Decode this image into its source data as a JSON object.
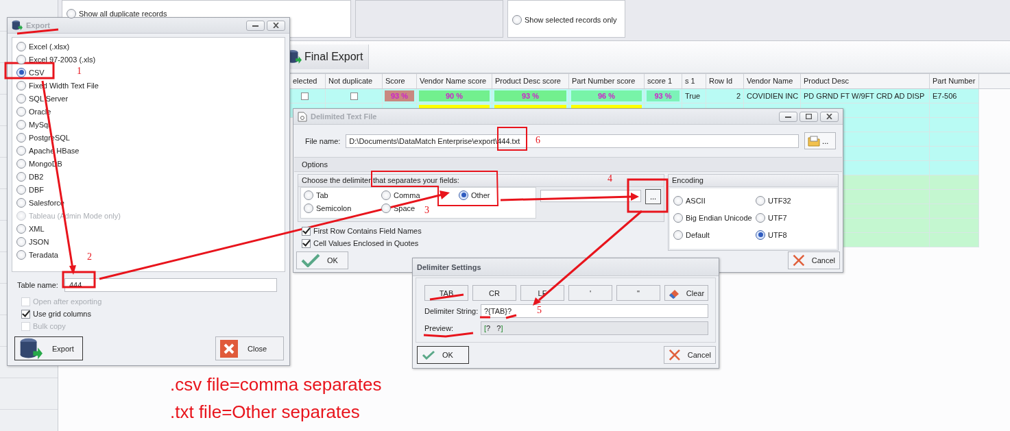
{
  "filter_panel": {
    "options": [
      {
        "label": "Show all duplicate records",
        "selected": false
      },
      {
        "label": "Show selected records only",
        "selected": false
      }
    ]
  },
  "toolbar": {
    "final_export": "Final Export"
  },
  "grid": {
    "columns": [
      "elected",
      "Not duplicate",
      "Score",
      "Vendor Name score",
      "Product Desc score",
      "Part Number score",
      "score 1",
      "s 1",
      "Row Id",
      "Vendor Name",
      "Product Desc",
      "Part Number"
    ],
    "rows": [
      {
        "color": "#b9fbf4",
        "cells": [
          {
            "kind": "checkbox",
            "checked": false
          },
          {
            "kind": "checkbox",
            "checked": false
          },
          {
            "kind": "match",
            "text": "93 %",
            "color": "#c98880"
          },
          {
            "kind": "match",
            "text": "90 %",
            "color": "#72f08e"
          },
          {
            "kind": "match",
            "text": "93 %",
            "color": "#72f08e"
          },
          {
            "kind": "match",
            "text": "96 %",
            "color": "#78f4a8"
          },
          {
            "kind": "match",
            "text": "93 %",
            "color": "#7cf2b8"
          },
          {
            "kind": "text",
            "text": "True"
          },
          {
            "kind": "number",
            "text": "2"
          },
          {
            "kind": "text",
            "text": "COVIDIEN INC"
          },
          {
            "kind": "text",
            "text": "PD GRND FT W/9FT CRD AD DISP"
          },
          {
            "kind": "text",
            "text": "E7-506"
          }
        ]
      },
      {
        "color": "#b9fbf4",
        "cells": [
          {
            "kind": "blank"
          },
          {
            "kind": "blank"
          },
          {
            "kind": "blank"
          },
          {
            "kind": "miss",
            "color": "#ffff00"
          },
          {
            "kind": "miss",
            "color": "#ffff00"
          },
          {
            "kind": "miss",
            "color": "#ffff00"
          }
        ]
      },
      {
        "color": "#b9fbf4"
      },
      {
        "color": "#b9fbf4"
      },
      {
        "color": "#b9fbf4"
      },
      {
        "color": "#b9fbf4"
      },
      {
        "color": "#c4f7d0"
      },
      {
        "color": "#c4f7d0"
      },
      {
        "color": "#c4f7d0"
      },
      {
        "color": "#c4f7d0"
      },
      {
        "color": "#c4f7d0"
      }
    ]
  },
  "export": {
    "title": "Export",
    "active": false,
    "formats": [
      {
        "label": "Excel (.xlsx)",
        "selected": false,
        "disabled": false
      },
      {
        "label": "Excel 97-2003 (.xls)",
        "selected": false,
        "disabled": false
      },
      {
        "label": "CSV",
        "selected": true,
        "disabled": false
      },
      {
        "label": "Fixed Width Text File",
        "selected": false,
        "disabled": false
      },
      {
        "label": "SQL Server",
        "selected": false,
        "disabled": false
      },
      {
        "label": "Oracle",
        "selected": false,
        "disabled": false
      },
      {
        "label": "MySql",
        "selected": false,
        "disabled": false
      },
      {
        "label": "PostgreSQL",
        "selected": false,
        "disabled": false
      },
      {
        "label": "Apache HBase",
        "selected": false,
        "disabled": false
      },
      {
        "label": "MongoDB",
        "selected": false,
        "disabled": false
      },
      {
        "label": "DB2",
        "selected": false,
        "disabled": false
      },
      {
        "label": "DBF",
        "selected": false,
        "disabled": false
      },
      {
        "label": "Salesforce",
        "selected": false,
        "disabled": false
      },
      {
        "label": "Tableau (Admin Mode only)",
        "selected": false,
        "disabled": true
      },
      {
        "label": "XML",
        "selected": false,
        "disabled": false
      },
      {
        "label": "JSON",
        "selected": false,
        "disabled": false
      },
      {
        "label": "Teradata",
        "selected": false,
        "disabled": false
      }
    ],
    "table_name_label": "Table name:",
    "table_name": "444",
    "options": [
      {
        "label": "Open after exporting",
        "checked": false,
        "disabled": true
      },
      {
        "label": "Use grid columns",
        "checked": true,
        "disabled": false
      },
      {
        "label": "Bulk copy",
        "checked": false,
        "disabled": true
      }
    ],
    "export_button": "Export",
    "close_button": "Close"
  },
  "delimited": {
    "title": "Delimited Text File",
    "active": false,
    "file_label": "File name:",
    "file_name": "D:\\Documents\\DataMatch Enterprise\\export\\444.txt",
    "browse_button": "...",
    "options_heading": "Options",
    "delimiter_heading": "Choose the delimiter that separates your fields:",
    "delimiters": [
      {
        "label": "Tab",
        "selected": false
      },
      {
        "label": "Comma",
        "selected": false
      },
      {
        "label": "Other",
        "selected": true
      },
      {
        "label": "Semicolon",
        "selected": false
      },
      {
        "label": "Space",
        "selected": false
      }
    ],
    "other_button": "...",
    "checks": [
      {
        "label": "First Row Contains Field Names",
        "checked": true
      },
      {
        "label": "Cell Values Enclosed in Quotes",
        "checked": true
      }
    ],
    "encoding_heading": "Encoding",
    "encodings": [
      {
        "label": "ASCII",
        "selected": false
      },
      {
        "label": "UTF32",
        "selected": false
      },
      {
        "label": "Big Endian Unicode",
        "selected": false
      },
      {
        "label": "UTF7",
        "selected": false
      },
      {
        "label": "Default",
        "selected": false
      },
      {
        "label": "UTF8",
        "selected": true
      }
    ],
    "ok": "OK",
    "cancel": "Cancel"
  },
  "delimiter_settings": {
    "title": "Delimiter Settings",
    "active": true,
    "buttons": [
      {
        "label": "TAB",
        "kind": "insert"
      },
      {
        "label": "CR",
        "kind": "insert"
      },
      {
        "label": "LF",
        "kind": "insert"
      },
      {
        "label": "'",
        "kind": "insert"
      },
      {
        "label": "\"",
        "kind": "insert"
      },
      {
        "label": "Clear",
        "kind": "clear"
      }
    ],
    "string_label": "Delimiter String:",
    "string_value": "?{TAB}?",
    "preview_label": "Preview:",
    "preview": "[?   ?]",
    "ok": "OK",
    "cancel": "Cancel"
  },
  "annotations": {
    "numbers": [
      "1",
      "2",
      "3",
      "4",
      "5",
      "6"
    ],
    "notes": [
      ".csv file=comma separates",
      ".txt file=Other separates"
    ]
  }
}
